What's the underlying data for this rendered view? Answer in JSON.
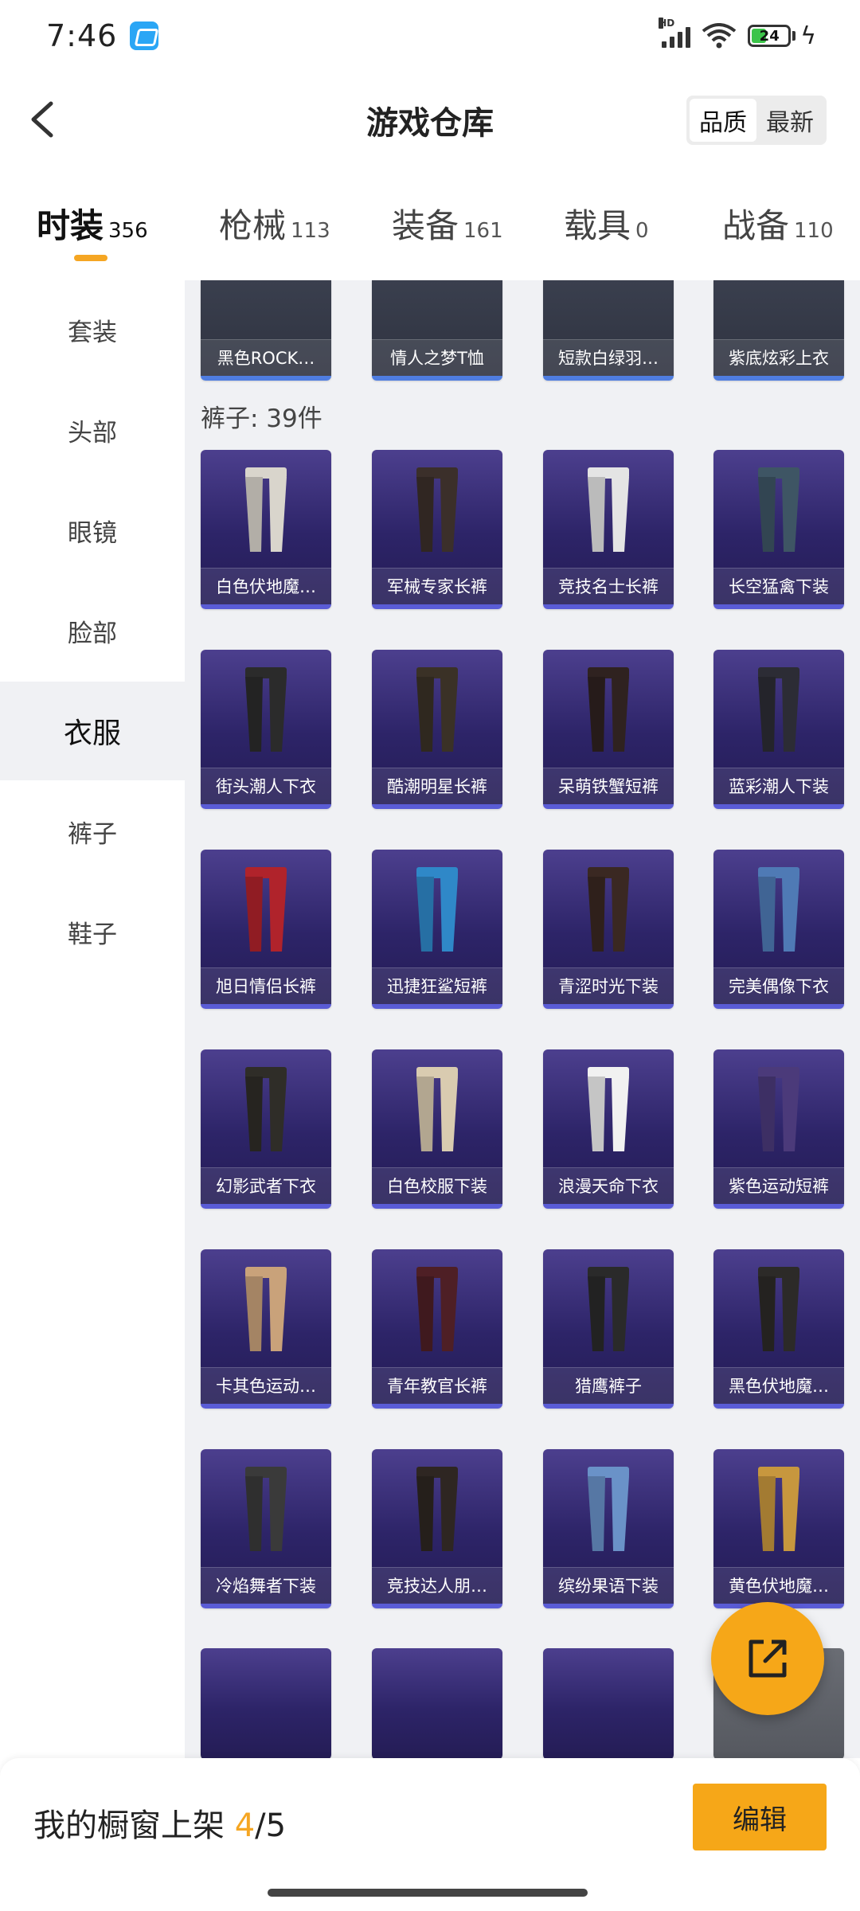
{
  "status_bar": {
    "time": "7:46",
    "battery_level": "24",
    "network_label": "HD"
  },
  "header": {
    "title": "游戏仓库",
    "sort_options": [
      "品质",
      "最新"
    ],
    "sort_active": "品质"
  },
  "tabs": [
    {
      "label": "时装",
      "count": "356",
      "active": true
    },
    {
      "label": "枪械",
      "count": "113",
      "active": false
    },
    {
      "label": "装备",
      "count": "161",
      "active": false
    },
    {
      "label": "载具",
      "count": "0",
      "active": false
    },
    {
      "label": "战备",
      "count": "110",
      "active": false
    }
  ],
  "sidebar": {
    "items": [
      {
        "label": "套装"
      },
      {
        "label": "头部"
      },
      {
        "label": "眼镜"
      },
      {
        "label": "脸部"
      },
      {
        "label": "衣服",
        "active": true
      },
      {
        "label": "裤子"
      },
      {
        "label": "鞋子"
      }
    ]
  },
  "content": {
    "top_row": [
      "黑色ROCK…",
      "情人之梦T恤",
      "短款白绿羽…",
      "紫底炫彩上衣"
    ],
    "section_label": "裤子: 39件",
    "items": [
      "白色伏地魔…",
      "军械专家长裤",
      "竞技名士长裤",
      "长空猛禽下装",
      "街头潮人下衣",
      "酷潮明星长裤",
      "呆萌铁蟹短裤",
      "蓝彩潮人下装",
      "旭日情侣长裤",
      "迅捷狂鲨短裤",
      "青涩时光下装",
      "完美偶像下衣",
      "幻影武者下衣",
      "白色校服下装",
      "浪漫天命下衣",
      "紫色运动短裤",
      "卡其色运动…",
      "青年教官长裤",
      "猎鹰裤子",
      "黑色伏地魔…",
      "冷焰舞者下装",
      "竞技达人朋…",
      "缤纷果语下装",
      "黄色伏地魔…"
    ]
  },
  "bottom_bar": {
    "showcase_prefix": "我的橱窗上架 ",
    "showcase_count": "4",
    "showcase_total": "/5",
    "edit_label": "编辑"
  },
  "colors": {
    "accent": "#f6a718",
    "card_bg": "#2d2468",
    "card_border": "#5a5cd6"
  },
  "icons": {
    "back": "chevron-left-icon",
    "share": "share-external-icon"
  }
}
